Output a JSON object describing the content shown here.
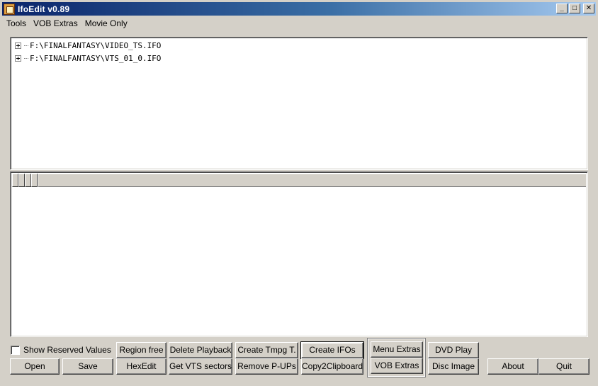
{
  "window": {
    "title": "IfoEdit v0.89",
    "minimize_glyph": "_",
    "maximize_glyph": "□",
    "close_glyph": "✕"
  },
  "menu": [
    "Tools",
    "VOB Extras",
    "Movie Only"
  ],
  "tree": {
    "items": [
      "F:\\FINALFANTASY\\VIDEO_TS.IFO",
      "F:\\FINALFANTASY\\VTS_01_0.IFO"
    ]
  },
  "options": {
    "show_reserved_label": "Show Reserved Values",
    "show_reserved_checked": false
  },
  "buttons": {
    "open": "Open",
    "save": "Save",
    "region_free": "Region free",
    "hexedit": "HexEdit",
    "delete_playback": "Delete Playback",
    "get_vts_sectors": "Get VTS sectors",
    "create_tmpg": "Create Tmpg T.",
    "remove_pups": "Remove P-UPs",
    "create_ifos": "Create IFOs",
    "copy2clipboard": "Copy2Clipboard",
    "menu_extras": "Menu Extras",
    "vob_extras": "VOB Extras",
    "dvd_play": "DVD Play",
    "disc_image": "Disc Image",
    "about": "About",
    "quit": "Quit"
  }
}
